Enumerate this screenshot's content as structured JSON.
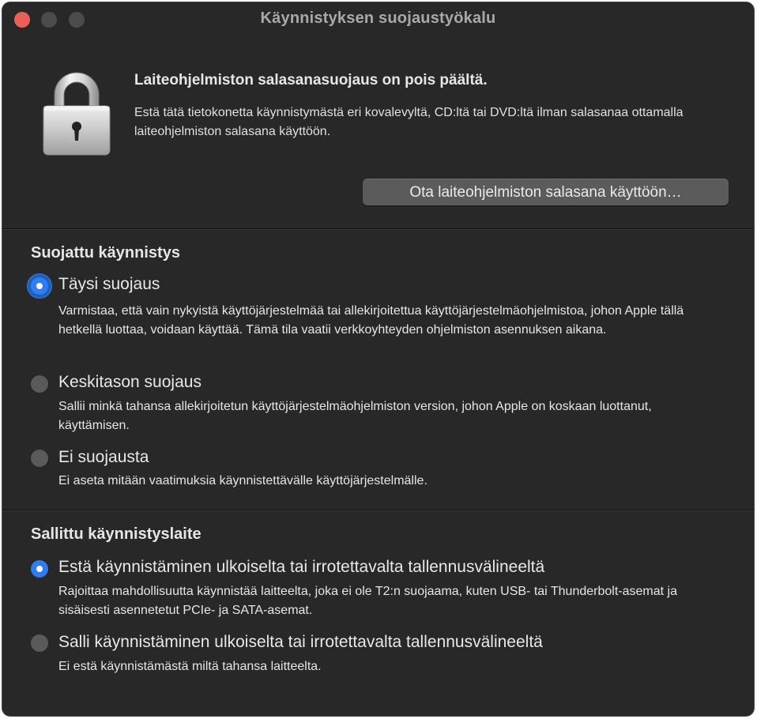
{
  "window": {
    "title": "Käynnistyksen suojaustyökalu"
  },
  "firmware": {
    "heading": "Laiteohjelmiston salasanasuojaus on pois päältä.",
    "description": "Estä tätä tietokonetta käynnistymästä eri kovalevyltä, CD:ltä tai DVD:ltä ilman salasanaa ottamalla laiteohjelmiston salasana käyttöön.",
    "button_label": "Ota laiteohjelmiston salasana käyttöön…"
  },
  "secure_boot": {
    "title": "Suojattu käynnistys",
    "selected": "full",
    "options": [
      {
        "id": "full",
        "label": "Täysi suojaus",
        "description": "Varmistaa, että vain nykyistä käyttöjärjestelmää tai allekirjoitettua käyttöjärjestelmäohjelmistoa, johon Apple tällä hetkellä luottaa, voidaan käyttää. Tämä tila vaatii verkkoyhteyden ohjelmiston asennuksen aikana."
      },
      {
        "id": "medium",
        "label": "Keskitason suojaus",
        "description": "Sallii minkä tahansa allekirjoitetun käyttöjärjestelmäohjelmiston version, johon Apple on koskaan luottanut, käyttämisen."
      },
      {
        "id": "none",
        "label": "Ei suojausta",
        "description": "Ei aseta mitään vaatimuksia käynnistettävälle käyttöjärjestelmälle."
      }
    ]
  },
  "external_boot": {
    "title": "Sallittu käynnistyslaite",
    "selected": "disallow",
    "options": [
      {
        "id": "disallow",
        "label": "Estä käynnistäminen ulkoiselta tai irrotettavalta tallennusvälineeltä",
        "description": "Rajoittaa mahdollisuutta käynnistää laitteelta, joka ei ole T2:n suojaama, kuten USB- tai Thunderbolt-asemat ja sisäisesti asennetetut PCIe- ja SATA-asemat."
      },
      {
        "id": "allow",
        "label": "Salli käynnistäminen ulkoiselta tai irrotettavalta tallennusvälineeltä",
        "description": "Ei estä käynnistämästä miltä tahansa laitteelta."
      }
    ]
  },
  "colors": {
    "window_bg": "#282828",
    "accent": "#2f7df6",
    "close_button": "#ec5f58"
  },
  "icons": {
    "lock": "padlock-icon"
  }
}
